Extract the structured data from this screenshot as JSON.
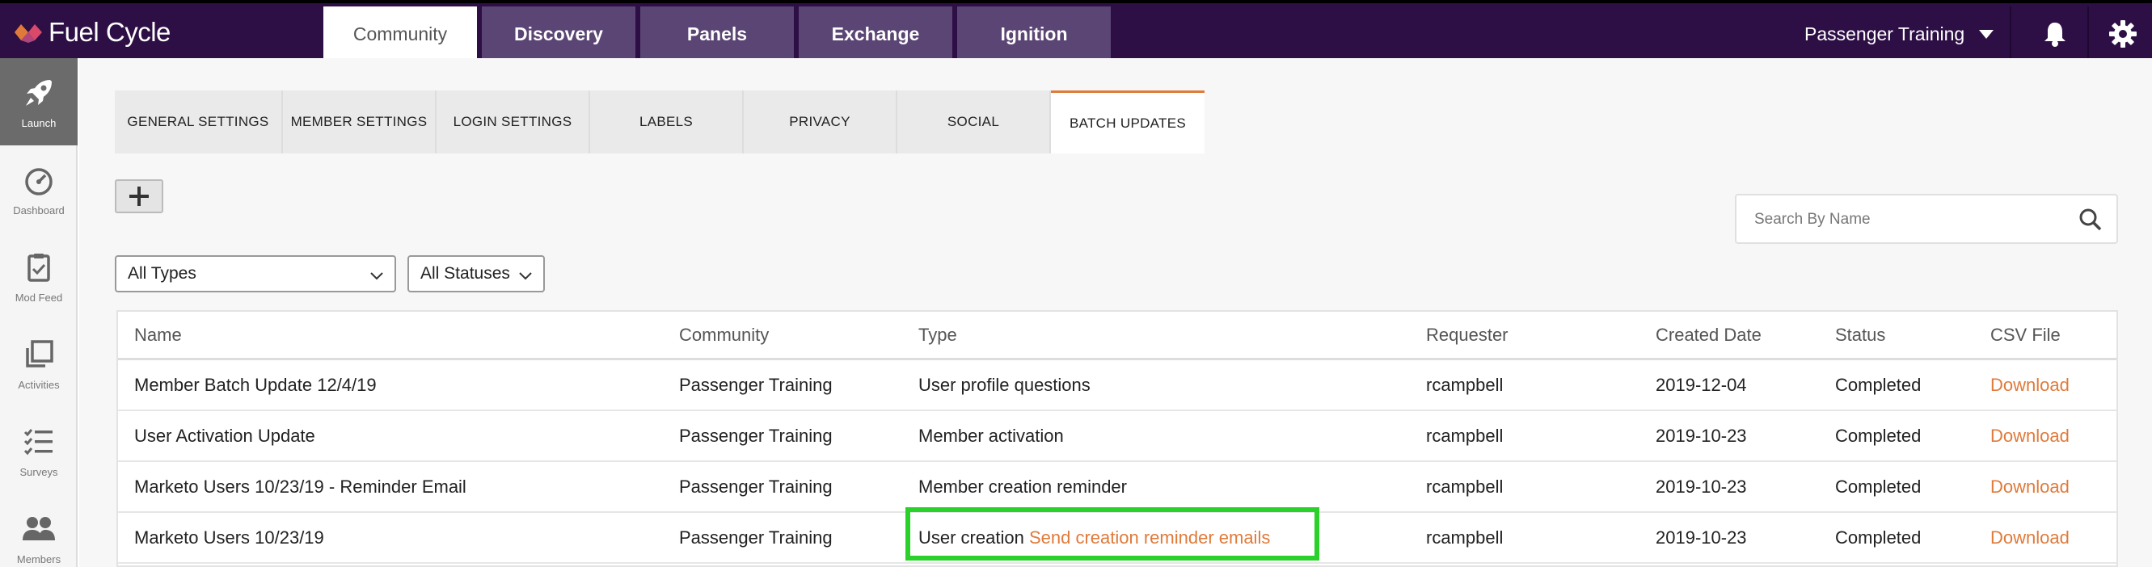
{
  "brand": {
    "name": "Fuel Cycle",
    "accent": "#e07a3a",
    "nav_bg": "#2d0f45"
  },
  "top_tabs": [
    {
      "label": "Community",
      "active": true
    },
    {
      "label": "Discovery",
      "active": false
    },
    {
      "label": "Panels",
      "active": false
    },
    {
      "label": "Exchange",
      "active": false
    },
    {
      "label": "Ignition",
      "active": false
    }
  ],
  "account": {
    "name": "Passenger Training",
    "bell_icon": "bell-icon",
    "gear_icon": "gear-icon"
  },
  "rail": [
    {
      "label": "Launch",
      "icon": "rocket-icon",
      "active": true
    },
    {
      "label": "Dashboard",
      "icon": "gauge-icon",
      "active": false
    },
    {
      "label": "Mod Feed",
      "icon": "clipboard-icon",
      "active": false
    },
    {
      "label": "Activities",
      "icon": "copy-icon",
      "active": false
    },
    {
      "label": "Surveys",
      "icon": "checklist-icon",
      "active": false
    },
    {
      "label": "Members",
      "icon": "users-icon",
      "active": false
    }
  ],
  "settings_tabs": [
    {
      "label": "GENERAL SETTINGS",
      "active": false
    },
    {
      "label": "MEMBER SETTINGS",
      "active": false
    },
    {
      "label": "LOGIN SETTINGS",
      "active": false
    },
    {
      "label": "LABELS",
      "active": false
    },
    {
      "label": "PRIVACY",
      "active": false
    },
    {
      "label": "SOCIAL",
      "active": false
    },
    {
      "label": "BATCH UPDATES",
      "active": true
    }
  ],
  "search": {
    "placeholder": "Search By Name",
    "value": ""
  },
  "filters": {
    "type": "All Types",
    "status": "All Statuses"
  },
  "table": {
    "headers": [
      "Name",
      "Community",
      "Type",
      "Requester",
      "Created Date",
      "Status",
      "CSV File"
    ],
    "rows": [
      {
        "name": "Member Batch Update 12/4/19",
        "community": "Passenger Training",
        "type": "User profile questions",
        "type_link": "",
        "requester": "rcampbell",
        "created": "2019-12-04",
        "status": "Completed",
        "csv": "Download"
      },
      {
        "name": "User Activation Update",
        "community": "Passenger Training",
        "type": "Member activation",
        "type_link": "",
        "requester": "rcampbell",
        "created": "2019-10-23",
        "status": "Completed",
        "csv": "Download"
      },
      {
        "name": "Marketo Users 10/23/19 - Reminder Email",
        "community": "Passenger Training",
        "type": "Member creation reminder",
        "type_link": "",
        "requester": "rcampbell",
        "created": "2019-10-23",
        "status": "Completed",
        "csv": "Download"
      },
      {
        "name": "Marketo Users 10/23/19",
        "community": "Passenger Training",
        "type": "User creation",
        "type_link": "Send creation reminder emails",
        "requester": "rcampbell",
        "created": "2019-10-23",
        "status": "Completed",
        "csv": "Download"
      }
    ]
  }
}
